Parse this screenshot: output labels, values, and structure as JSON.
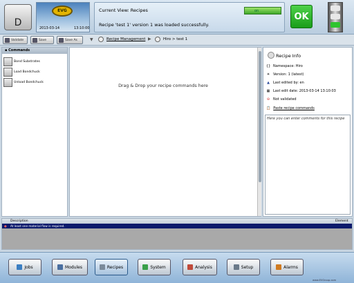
{
  "header": {
    "user_initial": "D",
    "logo": "EVG",
    "date": "2013-03-14",
    "time": "13:10:00",
    "current_view_label": "Current View: Recipes",
    "state_label": "on",
    "message": "Recipe 'test 1' version 1 was loaded successfully.",
    "ok_label": "OK"
  },
  "toolbar": {
    "buttons": [
      "Validate",
      "Save",
      "Save As"
    ],
    "breadcrumb_link": "Recipe Management",
    "breadcrumb_current": "Hiro > test 1"
  },
  "commands": {
    "header": "Commands",
    "items": [
      "Bond Substrates",
      "Load Bondchuck",
      "Unload Bondchuck"
    ]
  },
  "drop_area": {
    "hint": "Drag & Drop your recipe commands here"
  },
  "recipe_info": {
    "title": "Recipe Info",
    "rows": [
      {
        "icon": "namespace-icon",
        "glyph": "{}",
        "text": "Namespace: Hiro"
      },
      {
        "icon": "version-icon",
        "glyph": "✳",
        "text": "Version: 1 (latest)"
      },
      {
        "icon": "user-icon",
        "glyph": "▲",
        "text": "Last edited by: en"
      },
      {
        "icon": "calendar-icon",
        "glyph": "▦",
        "text": "Last edit date: 2013-03-14 13:10:03"
      },
      {
        "icon": "not-validated-icon",
        "glyph": "⊖",
        "text": "Not validated"
      }
    ],
    "paste_link": "Paste recipe commands",
    "comment_placeholder": "Here you can enter comments for this recipe"
  },
  "messages": {
    "col_description": "Description",
    "col_element": "Element",
    "rows": [
      {
        "text": "At least one material flow is required."
      }
    ]
  },
  "nav": {
    "items": [
      {
        "label": "Jobs",
        "icon": "jobs-icon",
        "color": "#3a7ec2"
      },
      {
        "label": "Modules",
        "icon": "modules-icon",
        "color": "#4a6fa0"
      },
      {
        "label": "Recipes",
        "icon": "recipes-icon",
        "color": "#7a8a9a"
      },
      {
        "label": "System",
        "icon": "system-icon",
        "color": "#3aa04a"
      },
      {
        "label": "Analysis",
        "icon": "analysis-icon",
        "color": "#c04a3a"
      },
      {
        "label": "Setup",
        "icon": "setup-icon",
        "color": "#6a7a8a"
      },
      {
        "label": "Alarms",
        "icon": "alarms-icon",
        "color": "#d07a20"
      }
    ],
    "active": "Recipes",
    "footer": "www.EVGroup.com"
  }
}
